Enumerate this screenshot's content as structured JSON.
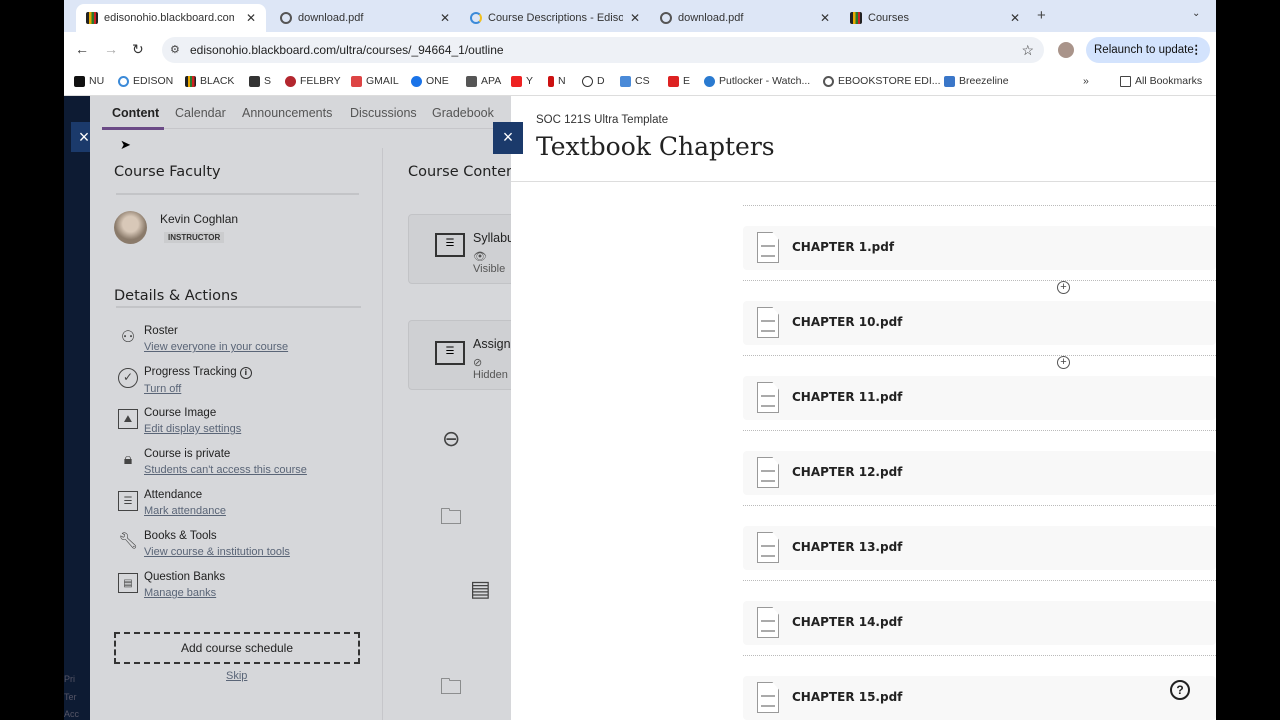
{
  "browser": {
    "tabs": [
      {
        "title": "edisonohio.blackboard.com/u",
        "icon": "blackboard-icon",
        "active": true
      },
      {
        "title": "download.pdf",
        "icon": "globe-icon"
      },
      {
        "title": "Course Descriptions - Edison",
        "icon": "edison-icon"
      },
      {
        "title": "download.pdf",
        "icon": "globe-icon"
      },
      {
        "title": "Courses",
        "icon": "blackboard-icon"
      }
    ],
    "url": "edisonohio.blackboard.com/ultra/courses/_94664_1/outline",
    "relaunch_label": "Relaunch to update",
    "bookmarks": [
      "NU",
      "EDISON",
      "BLACK",
      "S",
      "FELBRY",
      "GMAIL",
      "ONE",
      "APA",
      "Y",
      "N",
      "D",
      "CS",
      "E",
      "Putlocker - Watch...",
      "EBOOKSTORE EDI...",
      "Breezeline"
    ],
    "all_bookmarks_label": "All Bookmarks"
  },
  "course": {
    "tabs": [
      "Content",
      "Calendar",
      "Announcements",
      "Discussions",
      "Gradebook"
    ],
    "active_tab": "Content",
    "faculty_heading": "Course Faculty",
    "instructor_name": "Kevin Coghlan",
    "instructor_role": "INSTRUCTOR",
    "details_heading": "Details & Actions",
    "actions": [
      {
        "title": "Roster",
        "link": "View everyone in your course",
        "icon": "roster-icon"
      },
      {
        "title": "Progress Tracking",
        "link": "Turn off",
        "icon": "check-circle-icon"
      },
      {
        "title": "Course Image",
        "link": "Edit display settings",
        "icon": "image-icon"
      },
      {
        "title": "Course is private",
        "link": "Students can't access this course",
        "icon": "lock-icon"
      },
      {
        "title": "Attendance",
        "link": "Mark attendance",
        "icon": "attendance-icon"
      },
      {
        "title": "Books & Tools",
        "link": "View course & institution tools",
        "icon": "wrench-icon"
      },
      {
        "title": "Question Banks",
        "link": "Manage banks",
        "icon": "question-bank-icon"
      }
    ],
    "add_schedule_label": "Add course schedule",
    "skip_label": "Skip",
    "content_heading": "Course Content",
    "content_cards": [
      {
        "title": "Syllabus",
        "status": "Visible"
      },
      {
        "title": "Assign",
        "status": "Hidden"
      }
    ],
    "footer_links": [
      "Pri",
      "Ter",
      "Acc"
    ]
  },
  "panel": {
    "course_name": "SOC 121S Ultra Template",
    "title": "Textbook Chapters",
    "files": [
      "CHAPTER 1.pdf",
      "CHAPTER 10.pdf",
      "CHAPTER 11.pdf",
      "CHAPTER 12.pdf",
      "CHAPTER 13.pdf",
      "CHAPTER 14.pdf",
      "CHAPTER 15.pdf"
    ]
  }
}
